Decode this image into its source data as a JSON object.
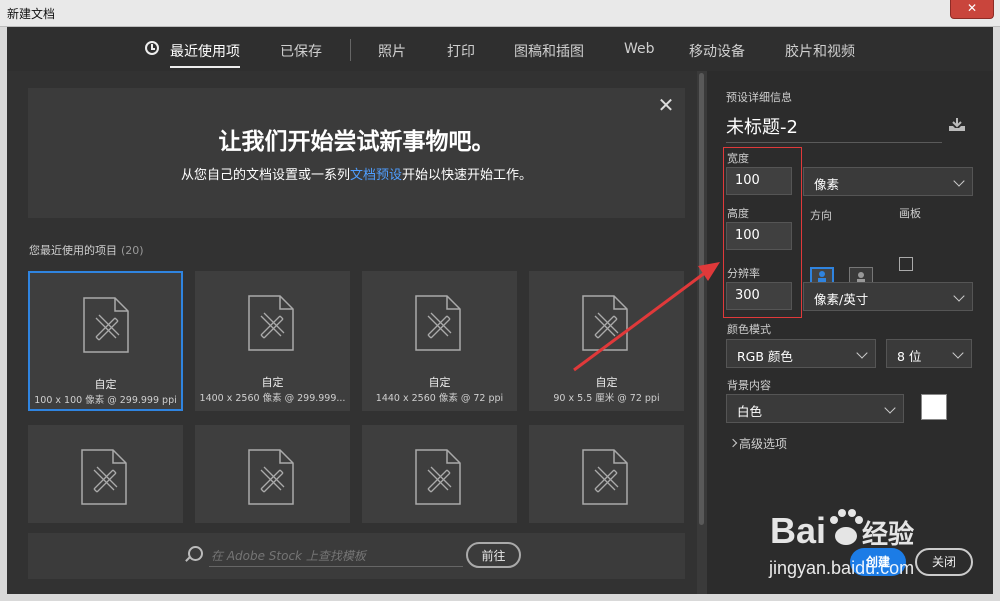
{
  "window": {
    "title": "新建文档",
    "close_glyph": "✕"
  },
  "tabs": [
    {
      "label": "最近使用项",
      "active": true
    },
    {
      "label": "已保存"
    },
    {
      "label": "照片"
    },
    {
      "label": "打印"
    },
    {
      "label": "图稿和插图"
    },
    {
      "label": "Web"
    },
    {
      "label": "移动设备"
    },
    {
      "label": "胶片和视频"
    }
  ],
  "welcome": {
    "heading": "让我们开始尝试新事物吧。",
    "sub_before": "从您自己的文档设置或一系列",
    "sub_link": "文档预设",
    "sub_after": "开始以快速开始工作。",
    "close_glyph": "✕"
  },
  "recent": {
    "label": "您最近使用的项目",
    "count": "(20)",
    "items": [
      {
        "name": "自定",
        "meta": "100 x 100 像素 @ 299.999 ppi",
        "selected": true
      },
      {
        "name": "自定",
        "meta": "1400 x 2560 像素 @ 299.999..."
      },
      {
        "name": "自定",
        "meta": "1440 x 2560 像素 @ 72 ppi"
      },
      {
        "name": "自定",
        "meta": "90 x 5.5 厘米 @ 72 ppi"
      }
    ]
  },
  "stock": {
    "placeholder": "在 Adobe Stock 上查找模板",
    "go_label": "前往"
  },
  "details": {
    "section_label": "预设详细信息",
    "doc_name": "未标题-2",
    "width_label": "宽度",
    "width_value": "100",
    "unit": "像素",
    "height_label": "高度",
    "height_value": "100",
    "orientation_label": "方向",
    "artboard_label": "画板",
    "resolution_label": "分辨率",
    "resolution_value": "300",
    "resolution_unit": "像素/英寸",
    "color_mode_label": "颜色模式",
    "color_mode": "RGB 颜色",
    "bit_depth": "8 位",
    "background_label": "背景内容",
    "background": "白色",
    "background_color": "#ffffff",
    "advanced_label": "高级选项",
    "create_label": "创建",
    "close_label": "关闭"
  },
  "colors": {
    "accent": "#2f84e0",
    "annotation": "#e0393a"
  },
  "watermark": {
    "brand": "Bai",
    "brand2": "du",
    "cn": "经验",
    "url": "jingyan.baidu.com"
  }
}
